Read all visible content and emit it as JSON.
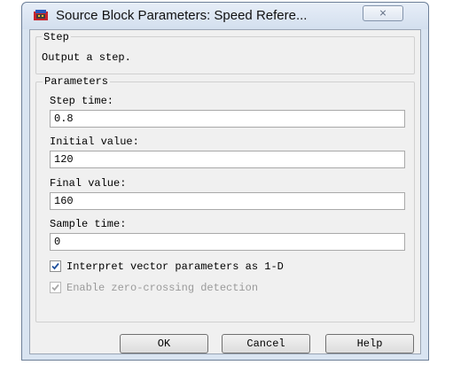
{
  "window": {
    "title": "Source Block Parameters: Speed Refere...",
    "close_symbol": "⨯"
  },
  "step_group": {
    "legend": "Step",
    "description": "Output a step."
  },
  "parameters": {
    "legend": "Parameters",
    "fields": [
      {
        "label": "Step time:",
        "value": "0.8"
      },
      {
        "label": "Initial value:",
        "value": "120"
      },
      {
        "label": "Final value:",
        "value": "160"
      },
      {
        "label": "Sample time:",
        "value": "0"
      }
    ],
    "checkboxes": [
      {
        "label": "Interpret vector parameters as 1-D",
        "checked": true,
        "enabled": true
      },
      {
        "label": "Enable zero-crossing detection",
        "checked": true,
        "enabled": false
      }
    ]
  },
  "buttons": {
    "ok": "OK",
    "cancel": "Cancel",
    "help": "Help"
  },
  "icons": {
    "app": "simulink-block-icon",
    "close": "close-icon",
    "check": "checkmark-icon"
  },
  "colors": {
    "title_bar": "#d3dfee",
    "client_bg": "#f0f0f0",
    "check_enabled": "#1e4f9c",
    "check_disabled": "#a8a8a8"
  }
}
